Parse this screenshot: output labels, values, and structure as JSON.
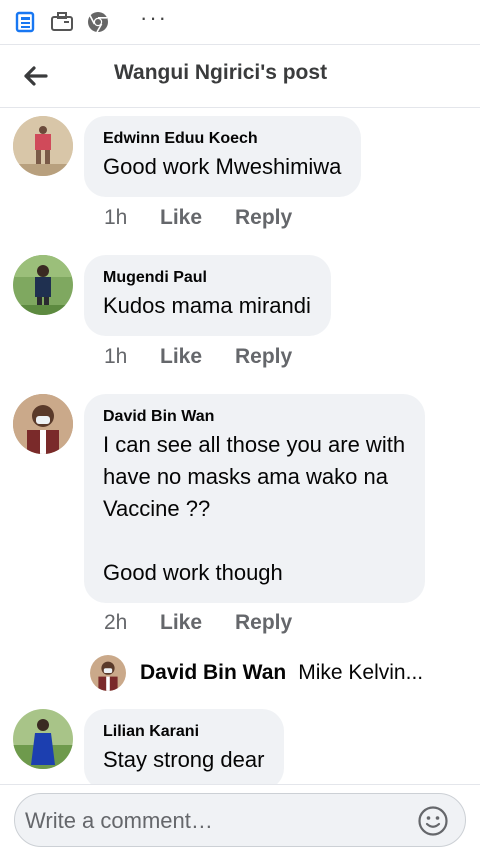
{
  "header": {
    "title": "Wangui Ngirici's post"
  },
  "status_bar": {
    "more": "···"
  },
  "comments": [
    {
      "author": "Edwinn Eduu Koech",
      "text": "Good work Mweshimiwa",
      "time": "1h",
      "like": "Like",
      "reply": "Reply"
    },
    {
      "author": "Mugendi Paul",
      "text": "Kudos mama mirandi",
      "time": "1h",
      "like": "Like",
      "reply": "Reply"
    },
    {
      "author": "David Bin Wan",
      "text": "I can see all those you are with\nhave no masks ama wako na\nVaccine ??\n\nGood work though",
      "time": "2h",
      "like": "Like",
      "reply": "Reply"
    },
    {
      "author": "Lilian Karani",
      "text": "Stay strong dear"
    }
  ],
  "reply_preview": {
    "author": "David Bin Wan",
    "text": "Mike Kelvin..."
  },
  "composer": {
    "placeholder": "Write a comment…"
  },
  "colors": {
    "accent": "#1877f2",
    "bubble": "#f0f2f5",
    "muted": "#65676b"
  },
  "icons": [
    "news-icon",
    "briefcase-icon",
    "chrome-icon",
    "more-icon",
    "back-arrow-icon",
    "emoji-icon"
  ]
}
